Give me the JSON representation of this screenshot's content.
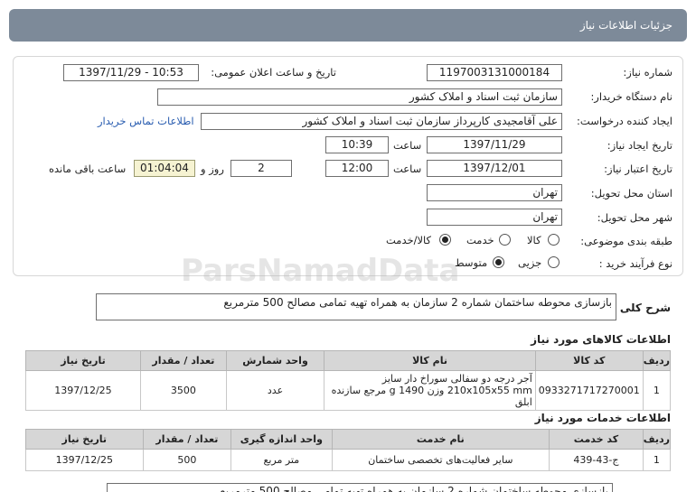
{
  "header": {
    "title": "جزئیات اطلاعات نیاز"
  },
  "fields": {
    "need_number_label": "شماره نیاز:",
    "need_number": "1197003131000184",
    "announce_label": "تاریخ و ساعت اعلان عمومی:",
    "announce_value": "1397/11/29 - 10:53",
    "buyer_label": "نام دستگاه خریدار:",
    "buyer_value": "سازمان ثبت اسناد و املاک کشور",
    "creator_label": "ایجاد کننده درخواست:",
    "creator_value": "علی آقامجیدی کارپرداز سازمان ثبت اسناد و املاک کشور",
    "contact_link": "اطلاعات تماس خریدار",
    "created_date_label": "تاریخ ایجاد نیاز:",
    "created_date": "1397/11/29",
    "time_label": "ساعت",
    "created_time": "10:39",
    "valid_date_label": "تاریخ اعتبار نیاز:",
    "valid_date": "1397/12/01",
    "valid_time": "12:00",
    "days_label": "روز و",
    "days_value": "2",
    "remaining_time": "01:04:04",
    "remaining_label": "ساعت باقی مانده",
    "province_label": "استان محل تحویل:",
    "province_value": "تهران",
    "city_label": "شهر محل تحویل:",
    "city_value": "تهران",
    "category_label": "طبقه بندی موضوعی:",
    "category_options": [
      "کالا",
      "خدمت",
      "کالا/خدمت"
    ],
    "process_label": "نوع فرآیند خرید :",
    "process_options": [
      "جزیی",
      "متوسط"
    ]
  },
  "description": {
    "label": "شرح کلی نیاز:",
    "value": "بازسازی محوطه ساختمان شماره 2 سازمان به همراه تهیه تمامی مصالح 500 مترمربع"
  },
  "goods": {
    "title": "اطلاعات کالاهای مورد نیاز",
    "headers": [
      "ردیف",
      "کد کالا",
      "نام کالا",
      "واحد شمارش",
      "تعداد / مقدار",
      "تاریخ نیاز"
    ],
    "rows": [
      [
        "1",
        "0933271717270001",
        "آجر درجه دو سفالی سوراخ دار سایز 210x105x55 mm وزن 1490 g مرجع سازنده ابلق",
        "عدد",
        "3500",
        "1397/12/25"
      ]
    ]
  },
  "services": {
    "title": "اطلاعات خدمات مورد نیاز",
    "headers": [
      "ردیف",
      "کد خدمت",
      "نام خدمت",
      "واحد اندازه گیری",
      "تعداد / مقدار",
      "تاریخ نیاز"
    ],
    "rows": [
      [
        "1",
        "ج-43-439",
        "سایر فعالیت‌های تخصصی ساختمان",
        "متر مربع",
        "500",
        "1397/12/25"
      ]
    ]
  },
  "footer_text": "بازسازی محوطه ساختمان شماره 2 سازمان به همراه تهیه تمامی مصالح 500 مترمربع",
  "watermark": "ParsNamadData"
}
